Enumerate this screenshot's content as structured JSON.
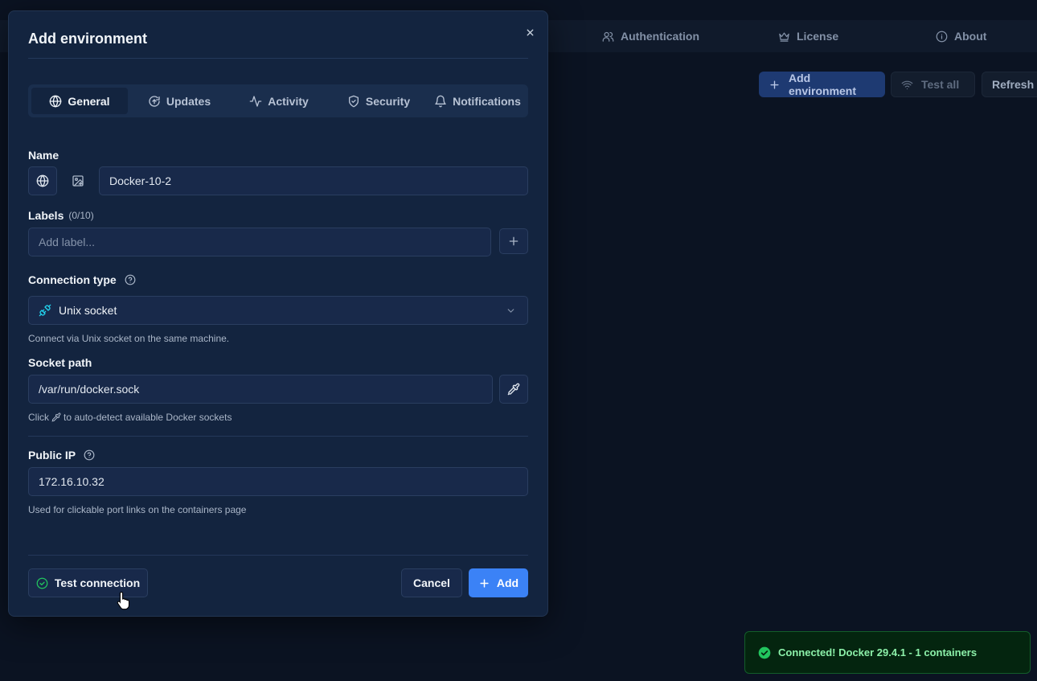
{
  "background": {
    "nav_tabs": [
      {
        "label": "Authentication",
        "icon": "users-icon"
      },
      {
        "label": "License",
        "icon": "crown-icon"
      },
      {
        "label": "About",
        "icon": "info-icon"
      }
    ],
    "toolbar": {
      "add_environment_label": "Add environment",
      "test_all_label": "Test all",
      "refresh_label": "Refresh"
    }
  },
  "modal": {
    "title": "Add environment",
    "tabs": [
      {
        "label": "General",
        "icon": "globe-icon",
        "active": true
      },
      {
        "label": "Updates",
        "icon": "upload-circle-icon",
        "active": false
      },
      {
        "label": "Activity",
        "icon": "activity-icon",
        "active": false
      },
      {
        "label": "Security",
        "icon": "shield-icon",
        "active": false
      },
      {
        "label": "Notifications",
        "icon": "bell-icon",
        "active": false
      }
    ],
    "name": {
      "label": "Name",
      "value": "Docker-10-2"
    },
    "labels": {
      "label": "Labels",
      "count": "(0/10)",
      "placeholder": "Add label..."
    },
    "connection_type": {
      "label": "Connection type",
      "selected": "Unix socket",
      "help": "Connect via Unix socket on the same machine."
    },
    "socket_path": {
      "label": "Socket path",
      "value": "/var/run/docker.sock",
      "help_before": "Click",
      "help_after": "to auto-detect available Docker sockets"
    },
    "public_ip": {
      "label": "Public IP",
      "value": "172.16.10.32",
      "help": "Used for clickable port links on the containers page"
    },
    "footer": {
      "test_connection_label": "Test connection",
      "cancel_label": "Cancel",
      "add_label": "Add"
    }
  },
  "toast": {
    "message": "Connected! Docker 29.4.1 - 1 containers"
  },
  "colors": {
    "accent": "#3b82f6",
    "success": "#22c55e",
    "modal_bg": "#13243f"
  }
}
